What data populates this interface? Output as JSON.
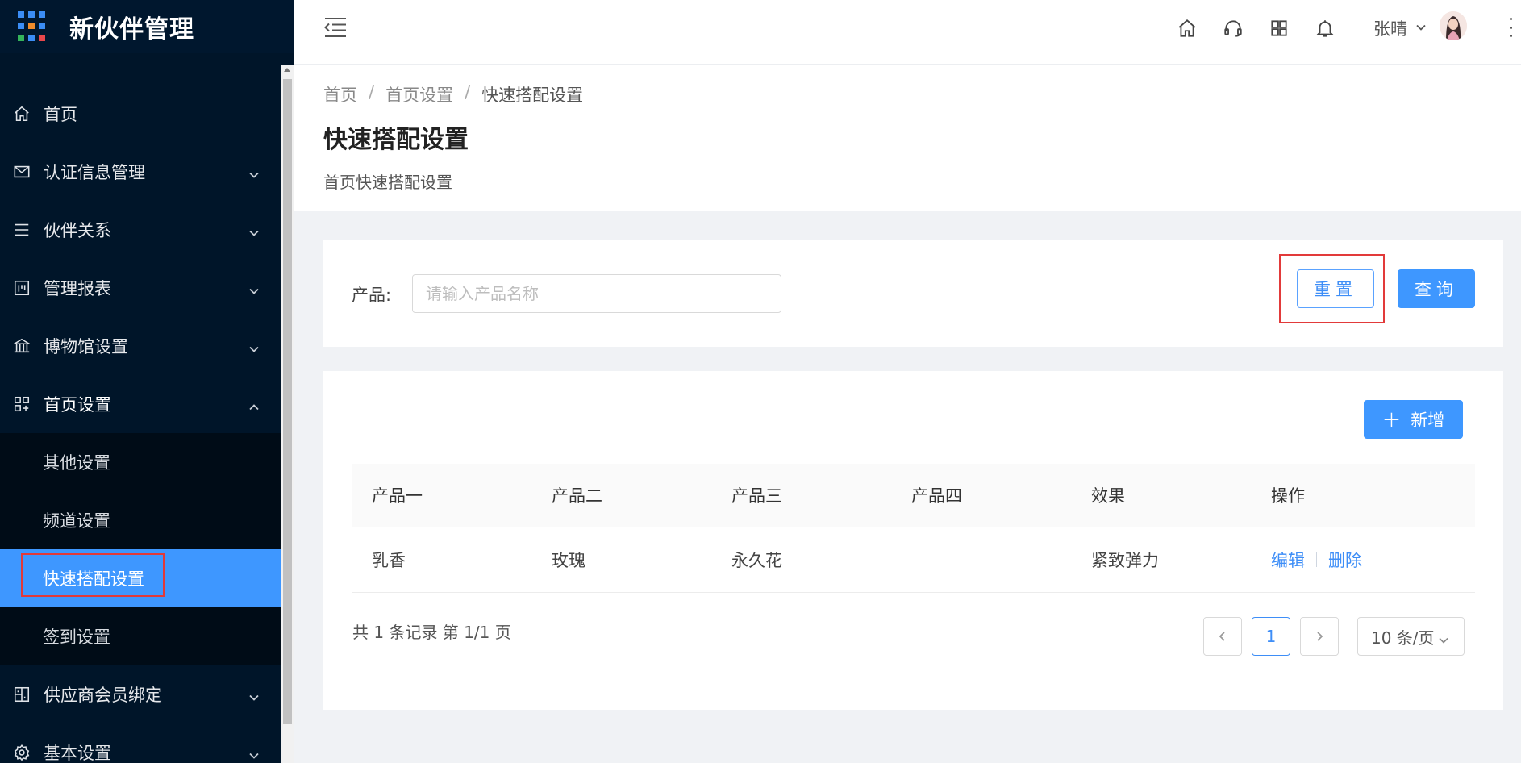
{
  "app": {
    "title": "新伙伴管理"
  },
  "sidebar": {
    "items": [
      {
        "label": "首页",
        "icon": "home-icon"
      },
      {
        "label": "认证信息管理",
        "icon": "mail-icon"
      },
      {
        "label": "伙伴关系",
        "icon": "list-icon"
      },
      {
        "label": "管理报表",
        "icon": "report-icon"
      },
      {
        "label": "博物馆设置",
        "icon": "bank-icon"
      },
      {
        "label": "首页设置",
        "icon": "appstore-add-icon"
      },
      {
        "label": "供应商会员绑定",
        "icon": "bind-icon"
      },
      {
        "label": "基本设置",
        "icon": "gear-icon"
      }
    ],
    "submenu": [
      {
        "label": "其他设置"
      },
      {
        "label": "频道设置"
      },
      {
        "label": "快速搭配设置",
        "selected": true
      },
      {
        "label": "签到设置"
      }
    ]
  },
  "header": {
    "icons": [
      "home-icon",
      "headset-icon",
      "grid-icon",
      "bell-icon"
    ],
    "user_name": "张晴"
  },
  "breadcrumb": {
    "items": [
      "首页",
      "首页设置",
      "快速搭配设置"
    ],
    "separator": "/"
  },
  "page": {
    "title": "快速搭配设置",
    "description": "首页快速搭配设置"
  },
  "search": {
    "label": "产品:",
    "placeholder": "请输入产品名称",
    "reset_label": "重置",
    "query_label": "查询"
  },
  "table": {
    "add_label": "新增",
    "columns": [
      "产品一",
      "产品二",
      "产品三",
      "产品四",
      "效果",
      "操作"
    ],
    "rows": [
      {
        "c1": "乳香",
        "c2": "玫瑰",
        "c3": "永久花",
        "c4": "",
        "c5": "紧致弹力",
        "edit": "编辑",
        "delete": "删除"
      }
    ]
  },
  "pagination": {
    "summary": "共 1 条记录 第 1/1 页",
    "current_page": "1",
    "page_size": "10 条/页"
  },
  "colors": {
    "sidebar_bg": "#001529",
    "accent": "#3e97ff",
    "highlight": "#e23a3a"
  }
}
